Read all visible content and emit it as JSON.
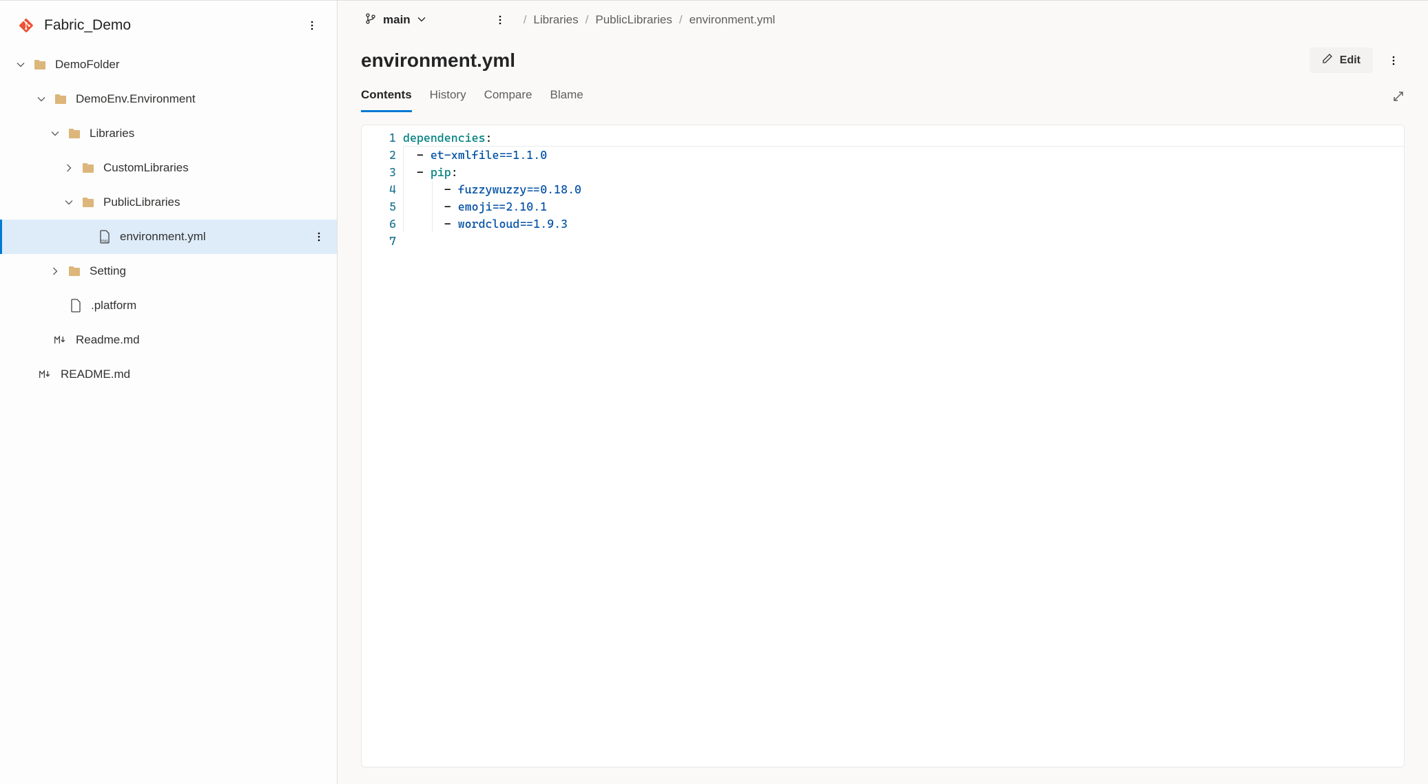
{
  "repo": {
    "name": "Fabric_Demo"
  },
  "tree": {
    "demoFolder": "DemoFolder",
    "demoEnv": "DemoEnv.Environment",
    "libraries": "Libraries",
    "customLibraries": "CustomLibraries",
    "publicLibraries": "PublicLibraries",
    "environmentYml": "environment.yml",
    "setting": "Setting",
    "platform": ".platform",
    "readme1": "Readme.md",
    "readme2": "README.md"
  },
  "branch": {
    "name": "main"
  },
  "breadcrumb": {
    "libraries": "Libraries",
    "publicLibraries": "PublicLibraries",
    "file": "environment.yml"
  },
  "file": {
    "title": "environment.yml"
  },
  "actions": {
    "edit": "Edit"
  },
  "tabs": {
    "contents": "Contents",
    "history": "History",
    "compare": "Compare",
    "blame": "Blame"
  },
  "code": {
    "key_dependencies": "dependencies",
    "et_xmlfile": "et-xmlfile==1.1.0",
    "pip": "pip",
    "fuzzywuzzy": "fuzzywuzzy==0.18.0",
    "emoji": "emoji==2.10.1",
    "wordcloud": "wordcloud==1.9.3"
  }
}
